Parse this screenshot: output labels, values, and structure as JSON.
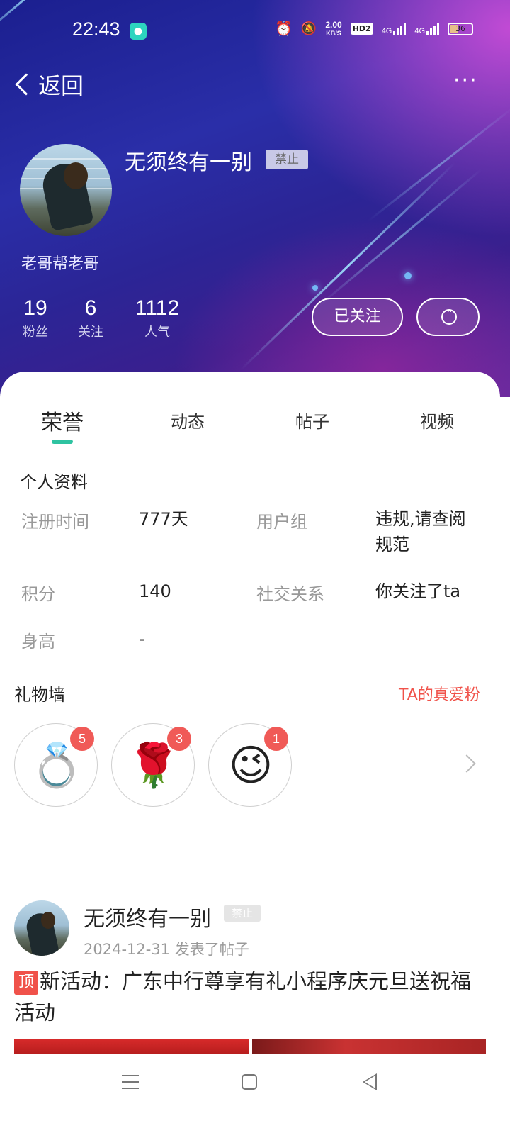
{
  "status_bar": {
    "time": "22:43",
    "net_speed_value": "2.00",
    "net_speed_unit": "KB/S",
    "hd_label": "HD2",
    "signal1_label": "4G",
    "signal2_label": "4G",
    "battery_level": "36"
  },
  "nav": {
    "back_label": "返回",
    "more_label": "···"
  },
  "profile": {
    "username": "无须终有一别",
    "ban_badge": "禁止",
    "motto": "老哥帮老哥",
    "stats": [
      {
        "value": "19",
        "label": "粉丝"
      },
      {
        "value": "6",
        "label": "关注"
      },
      {
        "value": "1112",
        "label": "人气"
      }
    ],
    "follow_button": "已关注"
  },
  "tabs": [
    {
      "label": "荣誉",
      "active": true
    },
    {
      "label": "动态",
      "active": false
    },
    {
      "label": "帖子",
      "active": false
    },
    {
      "label": "视频",
      "active": false
    }
  ],
  "info": {
    "title": "个人资料",
    "reg_time_label": "注册时间",
    "reg_time_value": "777天",
    "group_label": "用户组",
    "group_value": "违规,请查阅规范",
    "points_label": "积分",
    "points_value": "140",
    "social_label": "社交关系",
    "social_value": "你关注了ta",
    "height_label": "身高",
    "height_value": "-"
  },
  "gift_wall": {
    "title": "礼物墙",
    "fans_link": "TA的真爱粉",
    "gifts": [
      {
        "name": "diamond-ring",
        "count": "5"
      },
      {
        "name": "rose",
        "count": "3"
      },
      {
        "name": "thumbs-up-smiley",
        "count": "1"
      }
    ]
  },
  "post": {
    "author": "无须终有一别",
    "ban_badge": "禁止",
    "meta": "2024-12-31  发表了帖子",
    "top_tag": "顶",
    "title": "新活动：广东中行尊享有礼小程序庆元旦送祝福活动"
  },
  "colors": {
    "accent": "#2ec3a1",
    "link_red": "#f0524a"
  }
}
